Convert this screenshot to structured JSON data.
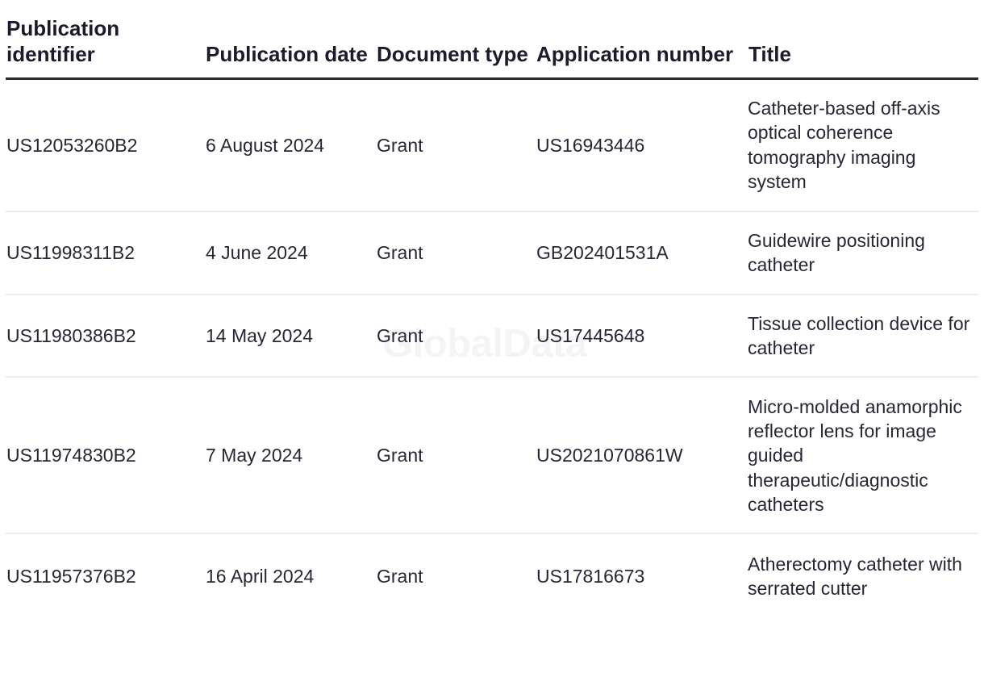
{
  "watermark": {
    "text": "GlobalData"
  },
  "table": {
    "columns": [
      {
        "key": "publication_identifier",
        "label": "Publication identifier"
      },
      {
        "key": "publication_date",
        "label": "Publication date"
      },
      {
        "key": "document_type",
        "label": "Document type"
      },
      {
        "key": "application_number",
        "label": "Application number"
      },
      {
        "key": "title",
        "label": "Title"
      }
    ],
    "rows": [
      {
        "publication_identifier": "US12053260B2",
        "publication_date": "6 August 2024",
        "document_type": "Grant",
        "application_number": "US16943446",
        "title": "Catheter-based off-axis optical coherence tomography imaging system"
      },
      {
        "publication_identifier": "US11998311B2",
        "publication_date": "4 June 2024",
        "document_type": "Grant",
        "application_number": "GB202401531A",
        "title": "Guidewire positioning catheter"
      },
      {
        "publication_identifier": "US11980386B2",
        "publication_date": "14 May 2024",
        "document_type": "Grant",
        "application_number": "US17445648",
        "title": "Tissue collection device for catheter"
      },
      {
        "publication_identifier": "US11974830B2",
        "publication_date": "7 May 2024",
        "document_type": "Grant",
        "application_number": "US2021070861W",
        "title": "Micro-molded anamorphic reflector lens for image guided therapeutic/diagnostic catheters"
      },
      {
        "publication_identifier": "US11957376B2",
        "publication_date": "16 April 2024",
        "document_type": "Grant",
        "application_number": "US17816673",
        "title": "Atherectomy catheter with serrated cutter"
      }
    ]
  },
  "colors": {
    "header_text": "#1b1b2b",
    "body_text": "#262637",
    "header_rule": "#2b2b30",
    "row_rule": "#ebebeb",
    "watermark": "#f4f4f5",
    "background": "#ffffff"
  }
}
